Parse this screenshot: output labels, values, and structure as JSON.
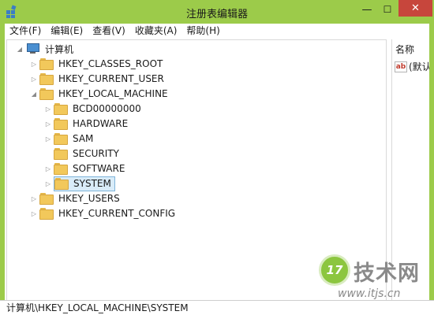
{
  "window": {
    "title": "注册表编辑器",
    "controls": {
      "minimize": "—",
      "maximize": "☐",
      "close": "✕"
    }
  },
  "colors": {
    "frame": "#9ccb4a",
    "close": "#c7463c",
    "selection": "#d9ecf9",
    "folder": "#f2c85b"
  },
  "menu": {
    "items": [
      {
        "label": "文件(F)"
      },
      {
        "label": "编辑(E)"
      },
      {
        "label": "查看(V)"
      },
      {
        "label": "收藏夹(A)"
      },
      {
        "label": "帮助(H)"
      }
    ]
  },
  "tree": {
    "root": {
      "label": "计算机",
      "icon": "computer-icon",
      "expanded": true
    },
    "hives": [
      {
        "label": "HKEY_CLASSES_ROOT",
        "expanded": false
      },
      {
        "label": "HKEY_CURRENT_USER",
        "expanded": false
      },
      {
        "label": "HKEY_LOCAL_MACHINE",
        "expanded": true
      },
      {
        "label": "HKEY_USERS",
        "expanded": false
      },
      {
        "label": "HKEY_CURRENT_CONFIG",
        "expanded": false
      }
    ],
    "hklm_children": [
      {
        "label": "BCD00000000",
        "has_children": true,
        "selected": false
      },
      {
        "label": "HARDWARE",
        "has_children": true,
        "selected": false
      },
      {
        "label": "SAM",
        "has_children": true,
        "selected": false
      },
      {
        "label": "SECURITY",
        "has_children": false,
        "selected": false
      },
      {
        "label": "SOFTWARE",
        "has_children": true,
        "selected": false
      },
      {
        "label": "SYSTEM",
        "has_children": true,
        "selected": true
      }
    ]
  },
  "values_pane": {
    "column_header": "名称",
    "rows": [
      {
        "icon": "string-value-icon",
        "icon_text": "ab",
        "name": "(默认"
      }
    ]
  },
  "status_bar": {
    "path": "计算机\\HKEY_LOCAL_MACHINE\\SYSTEM"
  },
  "watermark": {
    "logo": "17",
    "brand": "技术网",
    "url": "www.itjs.cn"
  }
}
